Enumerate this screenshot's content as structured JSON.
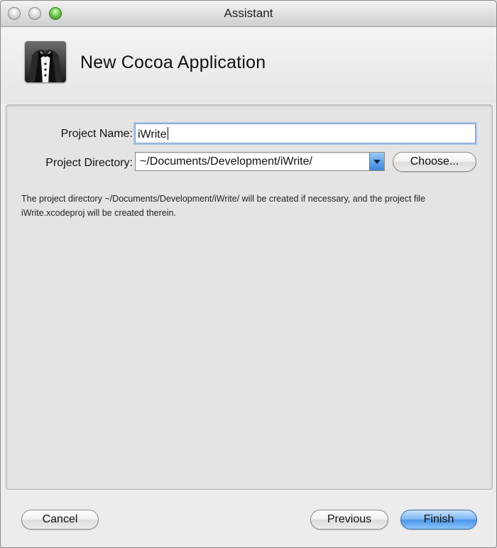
{
  "window": {
    "title": "Assistant"
  },
  "header": {
    "title": "New Cocoa Application",
    "icon": "tuxedo-app-icon"
  },
  "form": {
    "project_name_label": "Project Name:",
    "project_name_value": "iWrite",
    "project_directory_label": "Project Directory:",
    "project_directory_value": "~/Documents/Development/iWrite/",
    "choose_label": "Choose...",
    "description": "The project directory ~/Documents/Development/iWrite/ will be created if necessary, and the project file iWrite.xcodeproj will be created therein."
  },
  "footer": {
    "cancel_label": "Cancel",
    "previous_label": "Previous",
    "finish_label": "Finish"
  },
  "colors": {
    "default_button": "#4a95e8",
    "focus_ring": "#a8c4ea",
    "zoom_button": "#6cc34b"
  }
}
